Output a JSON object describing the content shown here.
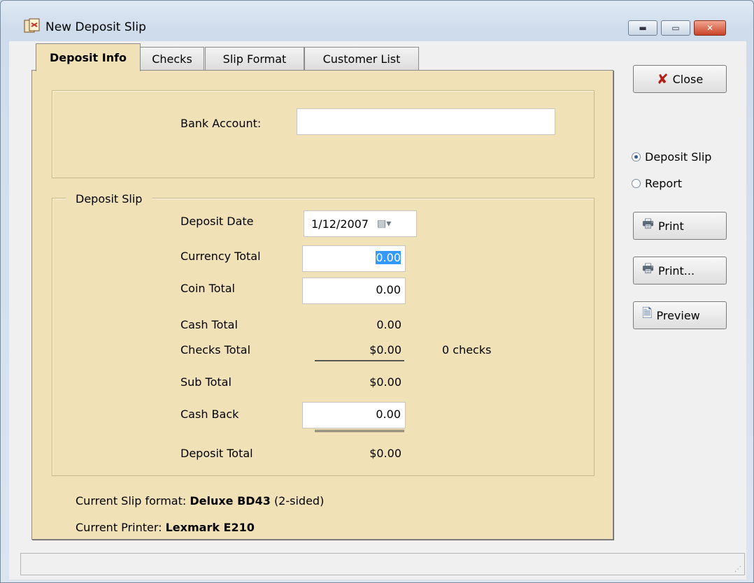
{
  "window": {
    "title": "New Deposit Slip",
    "minimize_icon": "minimize-icon",
    "maximize_icon": "maximize-icon",
    "close_icon": "close-icon"
  },
  "tabs": [
    {
      "label": "Deposit Info",
      "active": true
    },
    {
      "label": "Checks",
      "active": false
    },
    {
      "label": "Slip Format",
      "active": false
    },
    {
      "label": "Customer List",
      "active": false
    }
  ],
  "bank": {
    "label": "Bank Account:",
    "value": ""
  },
  "deposit_slip": {
    "group_label": "Deposit Slip",
    "deposit_date_label": "Deposit Date",
    "deposit_date": "1/12/2007",
    "currency_total_label": "Currency Total",
    "currency_total": "0.00",
    "coin_total_label": "Coin Total",
    "coin_total": "0.00",
    "cash_total_label": "Cash Total",
    "cash_total": "0.00",
    "checks_total_label": "Checks Total",
    "checks_total": "$0.00",
    "checks_count": "0 checks",
    "sub_total_label": "Sub Total",
    "sub_total": "$0.00",
    "cash_back_label": "Cash Back",
    "cash_back": "0.00",
    "deposit_total_label": "Deposit Total",
    "deposit_total": "$0.00"
  },
  "footer": {
    "slip_format_prefix": "Current Slip format:",
    "slip_format_name": "Deluxe BD43",
    "slip_format_suffix": "(2-sided)",
    "printer_prefix": "Current Printer:",
    "printer_name": "Lexmark E210"
  },
  "side": {
    "close_label": "Close",
    "radio_deposit_slip": "Deposit Slip",
    "radio_report": "Report",
    "print_label": "Print",
    "print_dialog_label": "Print...",
    "preview_label": "Preview"
  },
  "colors": {
    "panel": "#f1e1b7",
    "selection": "#3399ff"
  }
}
